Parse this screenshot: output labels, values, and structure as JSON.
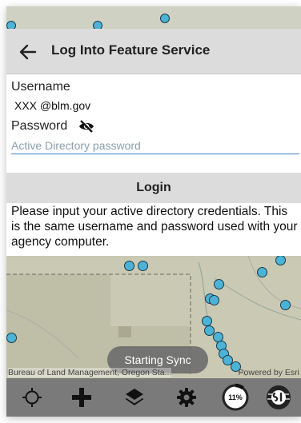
{
  "dialog": {
    "title": "Log Into Feature Service",
    "username_label": "Username",
    "username_value": "XXX @blm.gov",
    "password_label": "Password",
    "password_placeholder": "Active Directory password",
    "login_label": "Login",
    "message": "Please input your active directory credentials. This is the same username and password used with your agency computer."
  },
  "map": {
    "toast": "Starting Sync",
    "attribution_left": "Bureau of Land Management, Oregon Sta...",
    "attribution_right": "Powered by Esri",
    "point_color": "#4bb3d6"
  },
  "toolbar": {
    "progress_percent": 11,
    "progress_label": "11%",
    "items": [
      "location-target-icon",
      "add-icon",
      "layers-icon",
      "settings-icon",
      "sync-progress",
      "app-logo-icon"
    ]
  }
}
